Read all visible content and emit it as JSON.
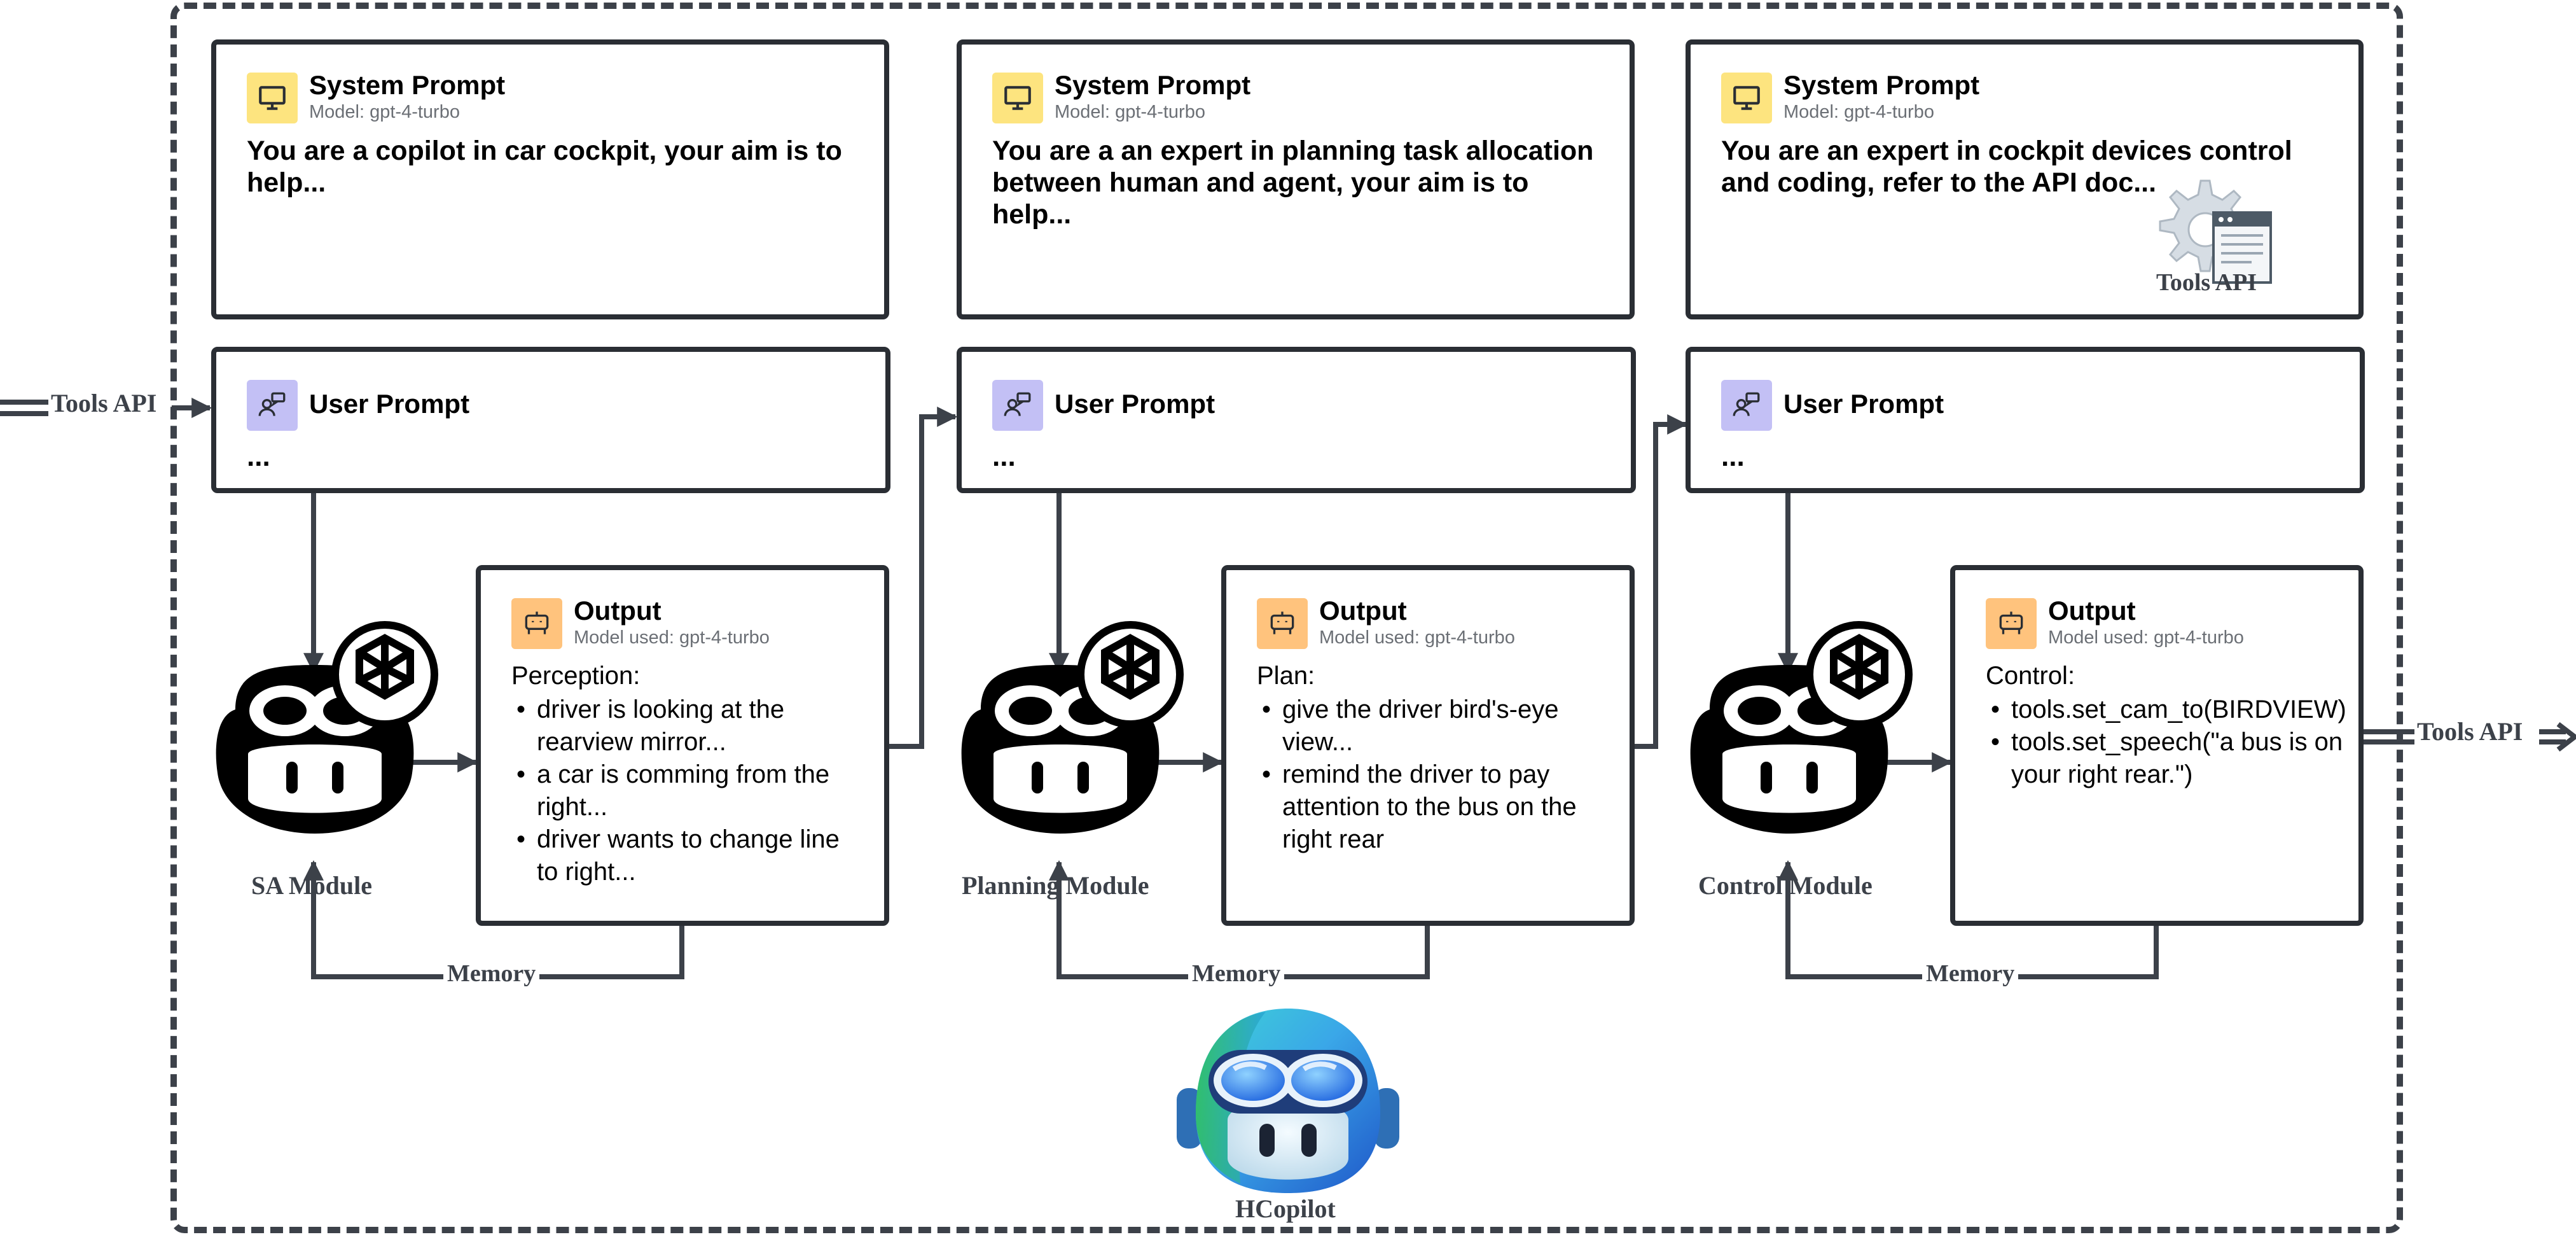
{
  "system_label": "System Prompt",
  "user_label": "User Prompt",
  "output_label": "Output",
  "memory_label": "Memory",
  "tools_api_label": "Tools API",
  "hcopilot_label": "HCopilot",
  "columns": [
    {
      "system": {
        "model": "Model: gpt-4-turbo",
        "text": "You are a copilot in car cockpit, your aim is to help..."
      },
      "user": {
        "text": "..."
      },
      "output": {
        "model": "Model used: gpt-4-turbo",
        "heading": "Perception:",
        "items": [
          "driver is looking at the rearview mirror...",
          "a car is comming from the right...",
          "driver wants to change line to right..."
        ]
      },
      "module": "SA Module"
    },
    {
      "system": {
        "model": "Model: gpt-4-turbo",
        "text": "You are a an expert in planning task allocation between human and agent, your aim is to help..."
      },
      "user": {
        "text": "..."
      },
      "output": {
        "model": "Model used: gpt-4-turbo",
        "heading": "Plan:",
        "items": [
          "give the driver bird's-eye view...",
          "remind the driver to pay attention to the bus on the right rear"
        ]
      },
      "module": "Planning Module"
    },
    {
      "system": {
        "model": "Model: gpt-4-turbo",
        "text": "You are an expert in cockpit devices control and coding, refer to the API doc..."
      },
      "user": {
        "text": "..."
      },
      "output": {
        "model": "Model used: gpt-4-turbo",
        "heading": "Control:",
        "items": [
          "tools.set_cam_to(BIRDVIEW)",
          "tools.set_speech(\"a bus is on your right rear.\")"
        ]
      },
      "module": "Control Module"
    }
  ],
  "colors": {
    "system_icon_bg": "#fde47f",
    "user_icon_bg": "#c3c0f5",
    "output_icon_bg": "#ffc37d",
    "line": "#3c4149"
  },
  "icons": {
    "system": "monitor-icon",
    "user": "user-message-icon",
    "output": "robot-icon",
    "agent": "copilot-robot-icon",
    "model": "openai-logo-icon",
    "tools": "gear-window-icon",
    "mascot": "hcopilot-mascot-icon"
  }
}
